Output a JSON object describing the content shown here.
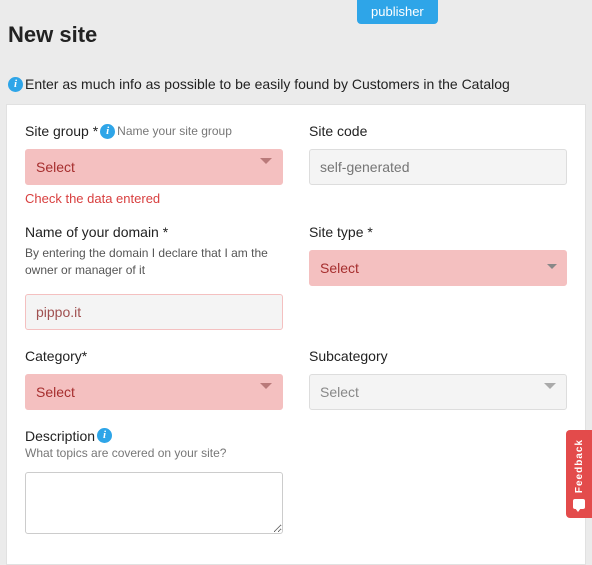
{
  "badge": "publisher",
  "title": "New site",
  "infoText": "Enter as much info as possible to be easily found by Customers in the Catalog",
  "fields": {
    "siteGroup": {
      "label": "Site group *",
      "hint": "Name your site group",
      "placeholder": "Select",
      "error": "Check the data entered"
    },
    "siteCode": {
      "label": "Site code",
      "placeholder": "self-generated"
    },
    "domain": {
      "label": "Name of your domain *",
      "declaration": "By entering the domain I declare that I am the owner or manager of it",
      "value": "pippo.it"
    },
    "siteType": {
      "label": "Site type *",
      "placeholder": "Select"
    },
    "category": {
      "label": "Category*",
      "placeholder": "Select"
    },
    "subcategory": {
      "label": "Subcategory",
      "placeholder": "Select"
    },
    "description": {
      "label": "Description",
      "hint": "What topics are covered on your site?"
    }
  },
  "feedback": "Feedback"
}
